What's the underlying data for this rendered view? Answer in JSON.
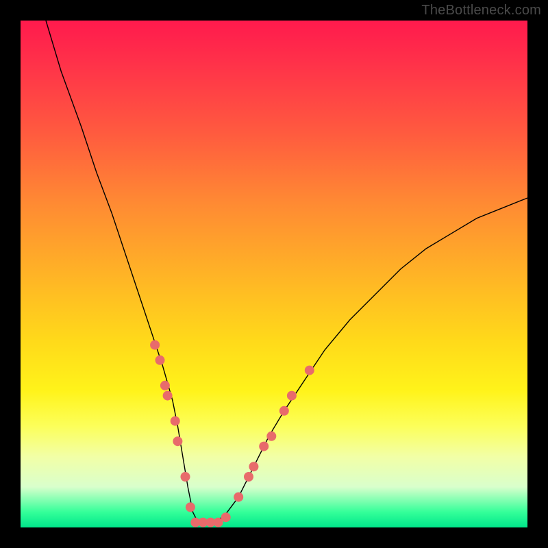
{
  "watermark": "TheBottleneck.com",
  "chart_data": {
    "type": "line",
    "title": "",
    "xlabel": "",
    "ylabel": "",
    "xlim": [
      0,
      100
    ],
    "ylim": [
      0,
      100
    ],
    "grid": false,
    "legend": false,
    "series": [
      {
        "name": "curve",
        "x": [
          5,
          8,
          12,
          15,
          18,
          20,
          22,
          24,
          26,
          28,
          30,
          31,
          32,
          33,
          34,
          35,
          37,
          40,
          43,
          46,
          49,
          52,
          56,
          60,
          65,
          70,
          75,
          80,
          85,
          90,
          95,
          100
        ],
        "y": [
          100,
          90,
          79,
          70,
          62,
          56,
          50,
          44,
          38,
          32,
          25,
          20,
          14,
          8,
          3,
          1,
          1,
          2,
          6,
          12,
          18,
          23,
          29,
          35,
          41,
          46,
          51,
          55,
          58,
          61,
          63,
          65
        ],
        "stroke": "#000000",
        "stroke_width": 1.4
      }
    ],
    "markers": {
      "color": "#e86b6b",
      "radius": 7,
      "points": [
        {
          "x": 26.5,
          "y": 36
        },
        {
          "x": 27.5,
          "y": 33
        },
        {
          "x": 28.5,
          "y": 28
        },
        {
          "x": 29.0,
          "y": 26
        },
        {
          "x": 30.5,
          "y": 21
        },
        {
          "x": 31.0,
          "y": 17
        },
        {
          "x": 32.5,
          "y": 10
        },
        {
          "x": 33.5,
          "y": 4
        },
        {
          "x": 34.5,
          "y": 1
        },
        {
          "x": 36.0,
          "y": 1
        },
        {
          "x": 37.5,
          "y": 1
        },
        {
          "x": 39.0,
          "y": 1
        },
        {
          "x": 40.5,
          "y": 2
        },
        {
          "x": 43.0,
          "y": 6
        },
        {
          "x": 45.0,
          "y": 10
        },
        {
          "x": 46.0,
          "y": 12
        },
        {
          "x": 48.0,
          "y": 16
        },
        {
          "x": 49.5,
          "y": 18
        },
        {
          "x": 52.0,
          "y": 23
        },
        {
          "x": 53.5,
          "y": 26
        },
        {
          "x": 57.0,
          "y": 31
        }
      ]
    }
  }
}
